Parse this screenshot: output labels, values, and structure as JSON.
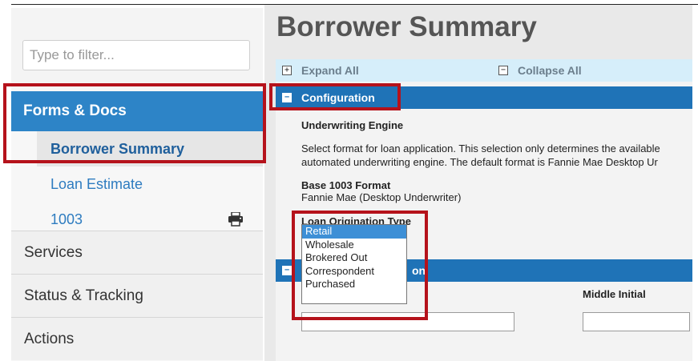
{
  "sidebar": {
    "filter_placeholder": "Type to filter...",
    "section_label": "Forms & Docs",
    "sub_items": [
      {
        "label": "Borrower Summary",
        "active": true
      },
      {
        "label": "Loan Estimate",
        "active": false
      },
      {
        "label": "1003",
        "active": false,
        "icon": "printer-icon"
      }
    ],
    "nav_items": [
      "Services",
      "Status & Tracking",
      "Actions"
    ]
  },
  "main": {
    "title": "Borrower Summary",
    "expand_all": "Expand All",
    "collapse_all": "Collapse All",
    "configuration_label": "Configuration",
    "underwriting_heading": "Underwriting Engine",
    "underwriting_desc_line1": "Select format for loan application. This selection only determines the available",
    "underwriting_desc_line2": "automated underwriting engine. The default format is Fannie Mae Desktop Ur",
    "base_format_label": "Base 1003 Format",
    "base_format_value": "Fannie Mae (Desktop Underwriter)",
    "loan_origination_label": "Loan Origination Type",
    "loan_origination_options": [
      "Retail",
      "Wholesale",
      "Brokered Out",
      "Correspondent",
      "Purchased"
    ],
    "loan_origination_selected": "Retail",
    "borrower_section_label": "on",
    "middle_initial_label": "Middle Initial"
  },
  "colors": {
    "accent_blue": "#2d84c7",
    "section_bar_blue": "#1f73b7",
    "highlight_red": "#b5121b"
  }
}
